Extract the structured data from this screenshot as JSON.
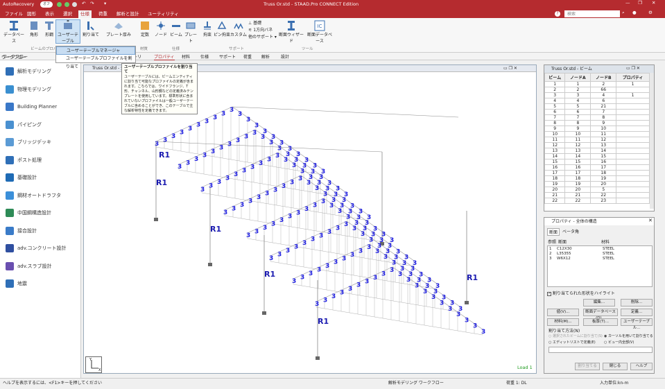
{
  "titlebar": {
    "autorecovery": "AutoRecovery",
    "toggle": "オフ",
    "title": "Truss Or.std - STAAD.Pro CONNECT Edition",
    "search_placeholder": "検索"
  },
  "menu": [
    "ファイル",
    "図形",
    "表示",
    "選択",
    "仕様",
    "荷重",
    "解析と設計",
    "ユーティリティ"
  ],
  "menu_active_index": 4,
  "ribbon": {
    "buttons": [
      "データベース",
      "角形",
      "形鋼",
      "ユーザーテーブル",
      "割り当て",
      "プレート厚み",
      "定数",
      "ノード",
      "ビーム",
      "プレート",
      "拘束",
      "ピン拘束",
      "カスタム",
      "基礎",
      "1方向バネ",
      "他のサポート",
      "断面ウィザード",
      "断面データベース"
    ],
    "groups": [
      "ビームのプロパティ",
      "材質",
      "仕様",
      "サポート",
      "ツール"
    ]
  },
  "dropdown": {
    "item1": "ユーザーテーブルマネージャ",
    "item2": "ユーザーテーブルプロファイルを割り当て"
  },
  "subtabs": [
    "ワークフロー",
    "トリ",
    "プロパティ",
    "材料",
    "仕様",
    "サポート",
    "荷重",
    "解析",
    "設計"
  ],
  "tooltip": {
    "title": "ユーザーテーブルプロファイルを割り当て",
    "body": "ユーザーテーブルには、ビームエンティティに割り当て可能なプロファイルの定義が含まれます。こちらでは、ワイドフランジ、T形、チャンネル、山形鋼などの定義済みテンプレートを使用しています。標準形状に含まれていないプロファイルは一般ユーザーテーブルに含めることができ、このテーブルで主な解析特性を定義できます。"
  },
  "workflow": {
    "title": "ワークフロー",
    "items": [
      "解析モデリング",
      "物理モデリング",
      "Building Planner",
      "パイピング",
      "ブリッジデッキ",
      "ポスト処理",
      "基礎設計",
      "鋼材オートドラフタ",
      "中国鋼構造設計",
      "接合設計",
      "adv.コンクリート設計",
      "adv.スラブ設計",
      "地震"
    ],
    "colors": [
      "#2f6fb7",
      "#3a8fd0",
      "#3a78c8",
      "#4a90d0",
      "#5b9bd5",
      "#2f6fb7",
      "#1f6bb5",
      "#3b8fd9",
      "#2e8b57",
      "#3a7bc8",
      "#2f4fa0",
      "#6a4fb0",
      "#2f6fb7"
    ]
  },
  "viewport": {
    "title": "Truss Or.std - 全",
    "labels": [
      "R1",
      "R1",
      "R1",
      "R1",
      "R1",
      "R1"
    ],
    "load": "Load 1"
  },
  "beam_window": {
    "title": "Truss Or.std - ビーム",
    "headers": [
      "ビーム",
      "ノードA",
      "ノードB",
      "プロパティ"
    ],
    "rows": [
      [
        "1",
        "1",
        "2",
        "1"
      ],
      [
        "2",
        "2",
        "66",
        ""
      ],
      [
        "3",
        "3",
        "4",
        "1"
      ],
      [
        "4",
        "4",
        "6",
        ""
      ],
      [
        "5",
        "5",
        "21",
        ""
      ],
      [
        "6",
        "6",
        "7",
        ""
      ],
      [
        "7",
        "7",
        "8",
        ""
      ],
      [
        "8",
        "8",
        "9",
        ""
      ],
      [
        "9",
        "9",
        "10",
        ""
      ],
      [
        "10",
        "10",
        "11",
        ""
      ],
      [
        "11",
        "11",
        "12",
        ""
      ],
      [
        "12",
        "12",
        "13",
        ""
      ],
      [
        "13",
        "13",
        "14",
        ""
      ],
      [
        "14",
        "14",
        "15",
        ""
      ],
      [
        "15",
        "15",
        "16",
        ""
      ],
      [
        "16",
        "16",
        "17",
        ""
      ],
      [
        "17",
        "17",
        "18",
        ""
      ],
      [
        "18",
        "18",
        "19",
        ""
      ],
      [
        "19",
        "19",
        "20",
        ""
      ],
      [
        "20",
        "20",
        "5",
        ""
      ],
      [
        "21",
        "21",
        "22",
        ""
      ],
      [
        "22",
        "22",
        "23",
        ""
      ]
    ]
  },
  "prop_window": {
    "title": "プロパティ - 全体の構造",
    "tabs": [
      "断面",
      "ベータ角"
    ],
    "list_headers": [
      "参照",
      "断面",
      "材料"
    ],
    "list_rows": [
      [
        "1",
        "C12X30",
        "STEEL"
      ],
      [
        "2",
        "L35355",
        "STEEL"
      ],
      [
        "3",
        "W6X12",
        "STEEL"
      ]
    ],
    "highlight_label": "割り当てられた形状をハイライト",
    "buttons": [
      "編集...",
      "削除...",
      "値(V)...",
      "断面データベース(D)...",
      "定義...",
      "材料(M)...",
      "板厚(T)...",
      "ユーザーテーブル..."
    ],
    "method_label": "割り当て方法(N)",
    "radios": [
      "選択されたビームに割り当て(S)",
      "カーソルを用いて割り当てる",
      "エディットリストで定義(E)",
      "ビュー内全部(V)"
    ],
    "bottom": [
      "割り当てる",
      "閉じる",
      "ヘルプ"
    ]
  },
  "status": {
    "help": "ヘルプを表示するには、<F1>キーを押してください",
    "workflow": "解析モデリング ワークフロー",
    "load": "荷重 1: DL",
    "units": "入力単位:kn-m"
  }
}
